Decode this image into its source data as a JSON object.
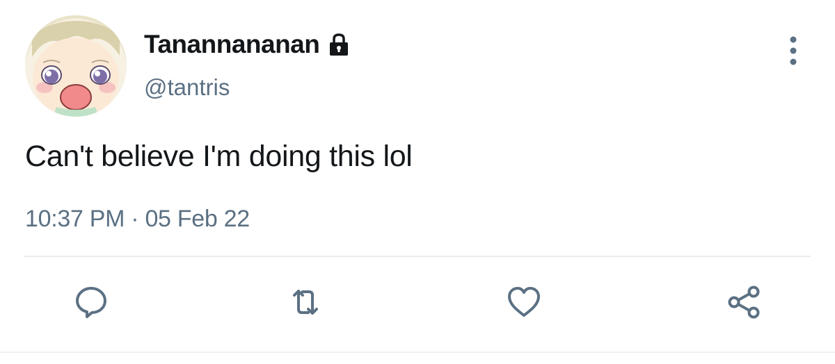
{
  "user": {
    "display_name": "Tanannananan",
    "handle": "@tantris",
    "protected_icon": "lock-icon",
    "avatar_icon": "anime-character-avatar"
  },
  "tweet": {
    "text": "Can't believe I'm doing this lol",
    "timestamp": "10:37 PM · 05 Feb 22"
  },
  "actions": {
    "reply_icon": "reply-icon",
    "retweet_icon": "retweet-icon",
    "like_icon": "heart-icon",
    "share_icon": "share-icon",
    "more_icon": "more-vertical-icon"
  },
  "colors": {
    "text_primary": "#14171a",
    "text_secondary": "#5b7083",
    "icon": "#5b7083",
    "divider": "#e6ecf0"
  }
}
